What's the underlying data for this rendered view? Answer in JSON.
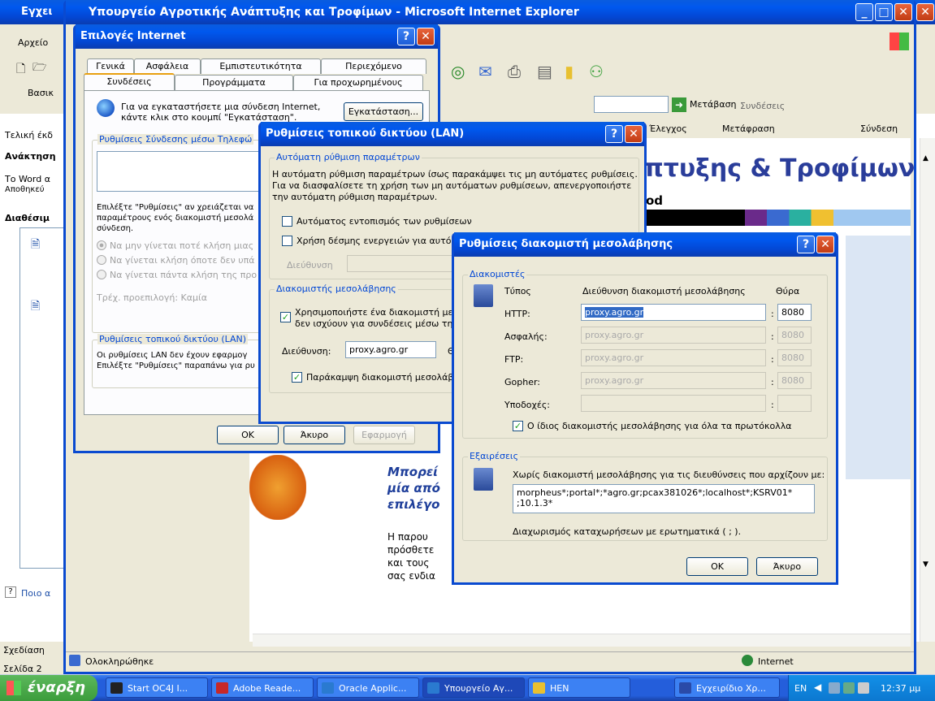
{
  "word": {
    "title": "Εγχει",
    "menu_file": "Αρχείο",
    "basic": "Βασικ",
    "left_tekh": "Τελική έκδ",
    "recovery": "Ανάκτηση",
    "word_text1": "Το Word α",
    "word_text2": "Αποθηκεύ",
    "available": "Διαθέσιμ",
    "help": "Ποιο α",
    "draw": "Σχεδίαση",
    "page": "Σελίδα 2"
  },
  "ie": {
    "title": "Υπουργείο Αγροτικής Ανάπτυξης και Τροφίμων - Microsoft Internet Explorer",
    "go": "Μετάβαση",
    "links": "Συνδέσεις",
    "check": "Έλεγχος",
    "translate": "Μετάφραση",
    "connect": "Σύνδεση",
    "status": "Ολοκληρώθηκε",
    "zone": "Internet",
    "banner": "πτυξης & Τροφίμων",
    "banner_sub": "od",
    "page_italic": [
      "Μπορεί",
      "μία από",
      "επιλέγο"
    ],
    "page_text": [
      "Η παρου",
      "πρόσθετε",
      "και τους",
      "σας ενδια"
    ]
  },
  "opts": {
    "title": "Επιλογές Internet",
    "tabs_top": [
      "Γενικά",
      "Ασφάλεια",
      "Εμπιστευτικότητα",
      "Περιεχόμενο"
    ],
    "tabs_bottom": [
      "Συνδέσεις",
      "Προγράμματα",
      "Για προχωρημένους"
    ],
    "setup_text1": "Για να εγκαταστήσετε μια σύνδεση Internet,",
    "setup_text2": "κάντε κλικ στο κουμπί \"Εγκατάσταση\".",
    "setup_btn": "Εγκατάσταση...",
    "dialup_group": "Ρυθμίσεις Σύνδεσης μέσω Τηλεφώ",
    "choose1": "Επιλέξτε \"Ρυθμίσεις\" αν χρειάζεται να",
    "choose2": "παραμέτρους ενός διακομιστή μεσολά",
    "choose3": "σύνδεση.",
    "radio1": "Να μην γίνεται ποτέ κλήση μιας",
    "radio2": "Να γίνεται κλήση όποτε δεν υπά",
    "radio3": "Να γίνεται πάντα κλήση της προ",
    "current": "Τρέχ. προεπιλογή: Καμία",
    "lan_group": "Ρυθμίσεις τοπικού δικτύου (LAN)",
    "lan1": "Οι ρυθμίσεις LAN δεν έχουν εφαρμογ",
    "lan2": "Επιλέξτε \"Ρυθμίσεις\" παραπάνω για ρυ",
    "ok": "OK",
    "cancel": "Άκυρο",
    "apply": "Εφαρμογή"
  },
  "lan": {
    "title": "Ρυθμίσεις τοπικού δικτύου (LAN)",
    "auto_group": "Αυτόματη ρύθμιση παραμέτρων",
    "auto1": "Η αυτόματη ρύθμιση παραμέτρων ίσως παρακάμψει τις μη αυτόματες ρυθμίσεις.",
    "auto2": "Για να διασφαλίσετε τη χρήση των μη αυτόματων ρυθμίσεων, απενεργοποιήστε",
    "auto3": "την αυτόματη ρύθμιση παραμέτρων.",
    "detect": "Αυτόματος εντοπισμός των ρυθμίσεων",
    "script": "Χρήση δέσμης ενεργειών για αυτόμα",
    "address_lbl": "Διεύθυνση",
    "proxy_group": "Διακομιστής μεσολάβησης",
    "use_proxy1": "Χρησιμοποιήστε ένα διακομιστή μεσο",
    "use_proxy2": "δεν ισχύουν για συνδέσεις μέσω τηλ",
    "addr_lbl": "Διεύθυνση:",
    "addr_val": "proxy.agro.gr",
    "port_lbl": "Θύρ",
    "bypass": "Παράκαμψη διακομιστή μεσολάβη"
  },
  "proxy": {
    "title": "Ρυθμίσεις διακομιστή μεσολάβησης",
    "servers_group": "Διακομιστές",
    "col_type": "Τύπος",
    "col_addr": "Διεύθυνση διακομιστή μεσολάβησης",
    "col_port": "Θύρα",
    "rows": [
      {
        "type": "HTTP:",
        "addr": "proxy.agro.gr",
        "port": "8080"
      },
      {
        "type": "Ασφαλής:",
        "addr": "proxy.agro.gr",
        "port": "8080"
      },
      {
        "type": "FTP:",
        "addr": "proxy.agro.gr",
        "port": "8080"
      },
      {
        "type": "Gopher:",
        "addr": "proxy.agro.gr",
        "port": "8080"
      },
      {
        "type": "Υποδοχές:",
        "addr": "",
        "port": ""
      }
    ],
    "same": "Ο ίδιος διακομιστής μεσολάβησης για όλα τα πρωτόκολλα",
    "except_group": "Εξαιρέσεις",
    "except_text": "Χωρίς διακομιστή μεσολάβησης για τις διευθύνσεις που αρχίζουν με:",
    "except1": "morpheus*;portal*;*agro.gr;pcax381026*;localhost*;KSRV01*",
    "except2": ";10.1.3*",
    "semicolon": "Διαχωρισμός καταχωρήσεων με ερωτηματικά ( ; ).",
    "ok": "OK",
    "cancel": "Άκυρο"
  },
  "taskbar": {
    "start": "έναρξη",
    "items": [
      "Start OC4J I...",
      "Adobe Reade...",
      "Oracle Applic...",
      "Υπουργείο Αγ...",
      "HEN",
      "Εγχειρίδιο Χρ..."
    ],
    "lang": "EN",
    "time": "12:37 μμ"
  },
  "colors": {
    "xp_blue": "#0a4ad0",
    "taskbar": "#245edb",
    "start": "#3c9c3c",
    "dialog": "#ece9d8"
  }
}
